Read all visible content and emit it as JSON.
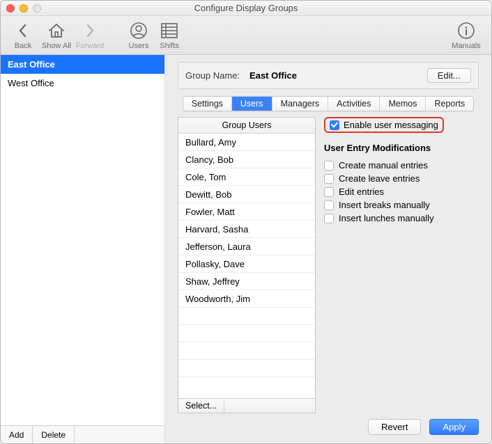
{
  "window": {
    "title": "Configure Display Groups"
  },
  "toolbar": {
    "back": "Back",
    "showall": "Show All",
    "forward": "Forward",
    "users": "Users",
    "shifts": "Shifts",
    "manuals": "Manuals"
  },
  "sidebar": {
    "items": [
      {
        "label": "East Office",
        "selected": true
      },
      {
        "label": "West Office",
        "selected": false
      }
    ],
    "add": "Add",
    "delete": "Delete"
  },
  "group": {
    "label": "Group Name:",
    "value": "East Office",
    "edit": "Edit..."
  },
  "tabs": [
    "Settings",
    "Users",
    "Managers",
    "Activities",
    "Memos",
    "Reports"
  ],
  "active_tab": "Users",
  "user_list": {
    "header": "Group Users",
    "items": [
      "Bullard, Amy",
      "Clancy, Bob",
      "Cole, Tom",
      "Dewitt, Bob",
      "Fowler, Matt",
      "Harvard, Sasha",
      "Jefferson, Laura",
      "Pollasky, Dave",
      "Shaw, Jeffrey",
      "Woodworth, Jim"
    ],
    "select": "Select..."
  },
  "options": {
    "enable_messaging": "Enable user messaging",
    "section": "User Entry Modifications",
    "items": [
      "Create manual entries",
      "Create leave entries",
      "Edit entries",
      "Insert breaks manually",
      "Insert lunches manually"
    ]
  },
  "footer": {
    "revert": "Revert",
    "apply": "Apply"
  }
}
